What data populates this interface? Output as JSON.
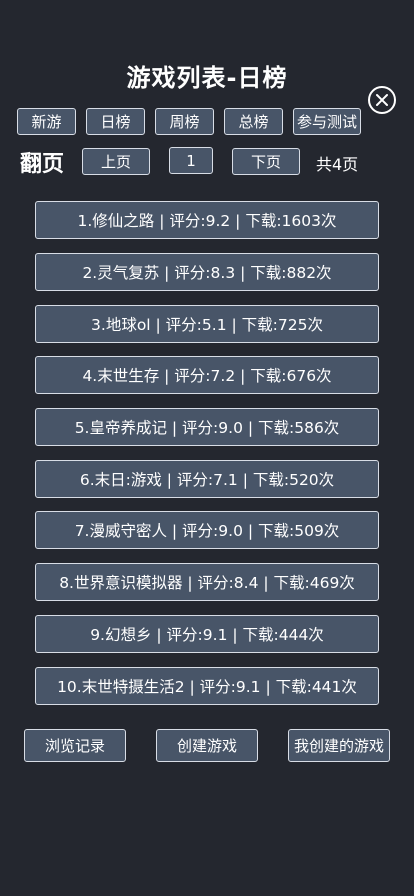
{
  "header": {
    "title": "游戏列表-日榜",
    "close_icon": "close-icon"
  },
  "tabs": [
    {
      "label": "新游"
    },
    {
      "label": "日榜"
    },
    {
      "label": "周榜"
    },
    {
      "label": "总榜"
    },
    {
      "label": "参与测试"
    }
  ],
  "pagination": {
    "label": "翻页",
    "prev_label": "上页",
    "current_page": "1",
    "next_label": "下页",
    "total_label": "共4页"
  },
  "games": [
    {
      "text": "1.修仙之路 | 评分:9.2 | 下载:1603次"
    },
    {
      "text": "2.灵气复苏 | 评分:8.3 | 下载:882次"
    },
    {
      "text": "3.地球ol | 评分:5.1 | 下载:725次"
    },
    {
      "text": "4.末世生存 | 评分:7.2 | 下载:676次"
    },
    {
      "text": "5.皇帝养成记 | 评分:9.0 | 下载:586次"
    },
    {
      "text": "6.末日:游戏 | 评分:7.1 | 下载:520次"
    },
    {
      "text": "7.漫威守密人 | 评分:9.0 | 下载:509次"
    },
    {
      "text": "8.世界意识模拟器 | 评分:8.4 | 下载:469次"
    },
    {
      "text": "9.幻想乡 | 评分:9.1 | 下载:444次"
    },
    {
      "text": "10.末世特摄生活2 | 评分:9.1 | 下载:441次"
    }
  ],
  "footer": {
    "history_label": "浏览记录",
    "create_label": "创建游戏",
    "my_games_label": "我创建的游戏"
  },
  "colors": {
    "background": "#24272f",
    "button_fill": "#485568",
    "button_border": "#d8dde6",
    "text": "#ffffff"
  }
}
